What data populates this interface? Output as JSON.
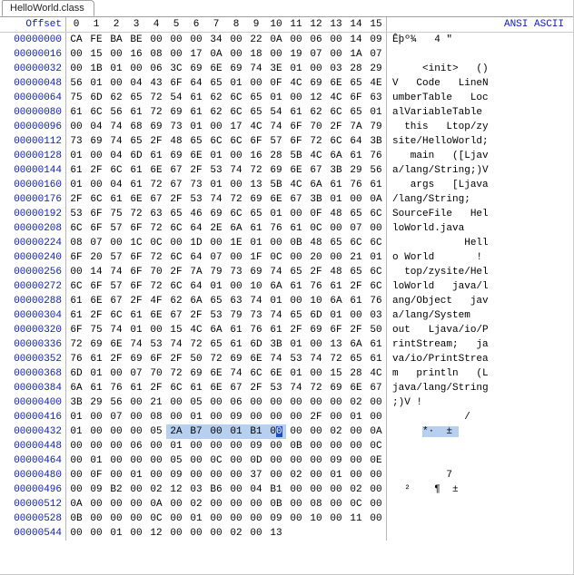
{
  "tab": {
    "label": "HelloWorld.class"
  },
  "headers": {
    "offset": "Offset",
    "cols": [
      "0",
      "1",
      "2",
      "3",
      "4",
      "5",
      "6",
      "7",
      "8",
      "9",
      "10",
      "11",
      "12",
      "13",
      "14",
      "15"
    ],
    "ascii": "ANSI ASCII"
  },
  "highlight": {
    "row": 27,
    "byteStart": 5,
    "byteEnd": 10,
    "cursor": 10
  },
  "rows": [
    {
      "off": "00000000",
      "hex": [
        "CA",
        "FE",
        "BA",
        "BE",
        "00",
        "00",
        "00",
        "34",
        "00",
        "22",
        "0A",
        "00",
        "06",
        "00",
        "14",
        "09"
      ],
      "asc": "Êþº¾   4 \""
    },
    {
      "off": "00000016",
      "hex": [
        "00",
        "15",
        "00",
        "16",
        "08",
        "00",
        "17",
        "0A",
        "00",
        "18",
        "00",
        "19",
        "07",
        "00",
        "1A",
        "07"
      ],
      "asc": ""
    },
    {
      "off": "00000032",
      "hex": [
        "00",
        "1B",
        "01",
        "00",
        "06",
        "3C",
        "69",
        "6E",
        "69",
        "74",
        "3E",
        "01",
        "00",
        "03",
        "28",
        "29"
      ],
      "asc": "     <init>   ()"
    },
    {
      "off": "00000048",
      "hex": [
        "56",
        "01",
        "00",
        "04",
        "43",
        "6F",
        "64",
        "65",
        "01",
        "00",
        "0F",
        "4C",
        "69",
        "6E",
        "65",
        "4E"
      ],
      "asc": "V   Code   LineN"
    },
    {
      "off": "00000064",
      "hex": [
        "75",
        "6D",
        "62",
        "65",
        "72",
        "54",
        "61",
        "62",
        "6C",
        "65",
        "01",
        "00",
        "12",
        "4C",
        "6F",
        "63"
      ],
      "asc": "umberTable   Loc"
    },
    {
      "off": "00000080",
      "hex": [
        "61",
        "6C",
        "56",
        "61",
        "72",
        "69",
        "61",
        "62",
        "6C",
        "65",
        "54",
        "61",
        "62",
        "6C",
        "65",
        "01"
      ],
      "asc": "alVariableTable "
    },
    {
      "off": "00000096",
      "hex": [
        "00",
        "04",
        "74",
        "68",
        "69",
        "73",
        "01",
        "00",
        "17",
        "4C",
        "74",
        "6F",
        "70",
        "2F",
        "7A",
        "79"
      ],
      "asc": "  this   Ltop/zy"
    },
    {
      "off": "00000112",
      "hex": [
        "73",
        "69",
        "74",
        "65",
        "2F",
        "48",
        "65",
        "6C",
        "6C",
        "6F",
        "57",
        "6F",
        "72",
        "6C",
        "64",
        "3B"
      ],
      "asc": "site/HelloWorld;"
    },
    {
      "off": "00000128",
      "hex": [
        "01",
        "00",
        "04",
        "6D",
        "61",
        "69",
        "6E",
        "01",
        "00",
        "16",
        "28",
        "5B",
        "4C",
        "6A",
        "61",
        "76"
      ],
      "asc": "   main   ([Ljav"
    },
    {
      "off": "00000144",
      "hex": [
        "61",
        "2F",
        "6C",
        "61",
        "6E",
        "67",
        "2F",
        "53",
        "74",
        "72",
        "69",
        "6E",
        "67",
        "3B",
        "29",
        "56"
      ],
      "asc": "a/lang/String;)V"
    },
    {
      "off": "00000160",
      "hex": [
        "01",
        "00",
        "04",
        "61",
        "72",
        "67",
        "73",
        "01",
        "00",
        "13",
        "5B",
        "4C",
        "6A",
        "61",
        "76",
        "61"
      ],
      "asc": "   args   [Ljava"
    },
    {
      "off": "00000176",
      "hex": [
        "2F",
        "6C",
        "61",
        "6E",
        "67",
        "2F",
        "53",
        "74",
        "72",
        "69",
        "6E",
        "67",
        "3B",
        "01",
        "00",
        "0A"
      ],
      "asc": "/lang/String;   "
    },
    {
      "off": "00000192",
      "hex": [
        "53",
        "6F",
        "75",
        "72",
        "63",
        "65",
        "46",
        "69",
        "6C",
        "65",
        "01",
        "00",
        "0F",
        "48",
        "65",
        "6C"
      ],
      "asc": "SourceFile   Hel"
    },
    {
      "off": "00000208",
      "hex": [
        "6C",
        "6F",
        "57",
        "6F",
        "72",
        "6C",
        "64",
        "2E",
        "6A",
        "61",
        "76",
        "61",
        "0C",
        "00",
        "07",
        "00"
      ],
      "asc": "loWorld.java    "
    },
    {
      "off": "00000224",
      "hex": [
        "08",
        "07",
        "00",
        "1C",
        "0C",
        "00",
        "1D",
        "00",
        "1E",
        "01",
        "00",
        "0B",
        "48",
        "65",
        "6C",
        "6C"
      ],
      "asc": "            Hell"
    },
    {
      "off": "00000240",
      "hex": [
        "6F",
        "20",
        "57",
        "6F",
        "72",
        "6C",
        "64",
        "07",
        "00",
        "1F",
        "0C",
        "00",
        "20",
        "00",
        "21",
        "01"
      ],
      "asc": "o World       ! "
    },
    {
      "off": "00000256",
      "hex": [
        "00",
        "14",
        "74",
        "6F",
        "70",
        "2F",
        "7A",
        "79",
        "73",
        "69",
        "74",
        "65",
        "2F",
        "48",
        "65",
        "6C"
      ],
      "asc": "  top/zysite/Hel"
    },
    {
      "off": "00000272",
      "hex": [
        "6C",
        "6F",
        "57",
        "6F",
        "72",
        "6C",
        "64",
        "01",
        "00",
        "10",
        "6A",
        "61",
        "76",
        "61",
        "2F",
        "6C"
      ],
      "asc": "loWorld   java/l"
    },
    {
      "off": "00000288",
      "hex": [
        "61",
        "6E",
        "67",
        "2F",
        "4F",
        "62",
        "6A",
        "65",
        "63",
        "74",
        "01",
        "00",
        "10",
        "6A",
        "61",
        "76"
      ],
      "asc": "ang/Object   jav"
    },
    {
      "off": "00000304",
      "hex": [
        "61",
        "2F",
        "6C",
        "61",
        "6E",
        "67",
        "2F",
        "53",
        "79",
        "73",
        "74",
        "65",
        "6D",
        "01",
        "00",
        "03"
      ],
      "asc": "a/lang/System   "
    },
    {
      "off": "00000320",
      "hex": [
        "6F",
        "75",
        "74",
        "01",
        "00",
        "15",
        "4C",
        "6A",
        "61",
        "76",
        "61",
        "2F",
        "69",
        "6F",
        "2F",
        "50"
      ],
      "asc": "out   Ljava/io/P"
    },
    {
      "off": "00000336",
      "hex": [
        "72",
        "69",
        "6E",
        "74",
        "53",
        "74",
        "72",
        "65",
        "61",
        "6D",
        "3B",
        "01",
        "00",
        "13",
        "6A",
        "61"
      ],
      "asc": "rintStream;   ja"
    },
    {
      "off": "00000352",
      "hex": [
        "76",
        "61",
        "2F",
        "69",
        "6F",
        "2F",
        "50",
        "72",
        "69",
        "6E",
        "74",
        "53",
        "74",
        "72",
        "65",
        "61"
      ],
      "asc": "va/io/PrintStrea"
    },
    {
      "off": "00000368",
      "hex": [
        "6D",
        "01",
        "00",
        "07",
        "70",
        "72",
        "69",
        "6E",
        "74",
        "6C",
        "6E",
        "01",
        "00",
        "15",
        "28",
        "4C"
      ],
      "asc": "m   println   (L"
    },
    {
      "off": "00000384",
      "hex": [
        "6A",
        "61",
        "76",
        "61",
        "2F",
        "6C",
        "61",
        "6E",
        "67",
        "2F",
        "53",
        "74",
        "72",
        "69",
        "6E",
        "67"
      ],
      "asc": "java/lang/String"
    },
    {
      "off": "00000400",
      "hex": [
        "3B",
        "29",
        "56",
        "00",
        "21",
        "00",
        "05",
        "00",
        "06",
        "00",
        "00",
        "00",
        "00",
        "00",
        "02",
        "00"
      ],
      "asc": ";)V !           "
    },
    {
      "off": "00000416",
      "hex": [
        "01",
        "00",
        "07",
        "00",
        "08",
        "00",
        "01",
        "00",
        "09",
        "00",
        "00",
        "00",
        "2F",
        "00",
        "01",
        "00"
      ],
      "asc": "            /   "
    },
    {
      "off": "00000432",
      "hex": [
        "01",
        "00",
        "00",
        "00",
        "05",
        "2A",
        "B7",
        "00",
        "01",
        "B1",
        "00",
        "00",
        "00",
        "02",
        "00",
        "0A"
      ],
      "asc": "     *·  ±      "
    },
    {
      "off": "00000448",
      "hex": [
        "00",
        "00",
        "00",
        "06",
        "00",
        "01",
        "00",
        "00",
        "00",
        "09",
        "00",
        "0B",
        "00",
        "00",
        "00",
        "0C"
      ],
      "asc": "                "
    },
    {
      "off": "00000464",
      "hex": [
        "00",
        "01",
        "00",
        "00",
        "00",
        "05",
        "00",
        "0C",
        "00",
        "0D",
        "00",
        "00",
        "00",
        "09",
        "00",
        "0E"
      ],
      "asc": "                "
    },
    {
      "off": "00000480",
      "hex": [
        "00",
        "0F",
        "00",
        "01",
        "00",
        "09",
        "00",
        "00",
        "00",
        "37",
        "00",
        "02",
        "00",
        "01",
        "00",
        "00"
      ],
      "asc": "         7      "
    },
    {
      "off": "00000496",
      "hex": [
        "00",
        "09",
        "B2",
        "00",
        "02",
        "12",
        "03",
        "B6",
        "00",
        "04",
        "B1",
        "00",
        "00",
        "00",
        "02",
        "00"
      ],
      "asc": "  ²    ¶  ±     "
    },
    {
      "off": "00000512",
      "hex": [
        "0A",
        "00",
        "00",
        "00",
        "0A",
        "00",
        "02",
        "00",
        "00",
        "00",
        "0B",
        "00",
        "08",
        "00",
        "0C",
        "00"
      ],
      "asc": "                "
    },
    {
      "off": "00000528",
      "hex": [
        "0B",
        "00",
        "00",
        "00",
        "0C",
        "00",
        "01",
        "00",
        "00",
        "00",
        "09",
        "00",
        "10",
        "00",
        "11",
        "00"
      ],
      "asc": "                "
    },
    {
      "off": "00000544",
      "hex": [
        "00",
        "00",
        "01",
        "00",
        "12",
        "00",
        "00",
        "00",
        "02",
        "00",
        "13",
        "",
        "",
        "",
        "",
        ""
      ],
      "asc": "                "
    }
  ]
}
